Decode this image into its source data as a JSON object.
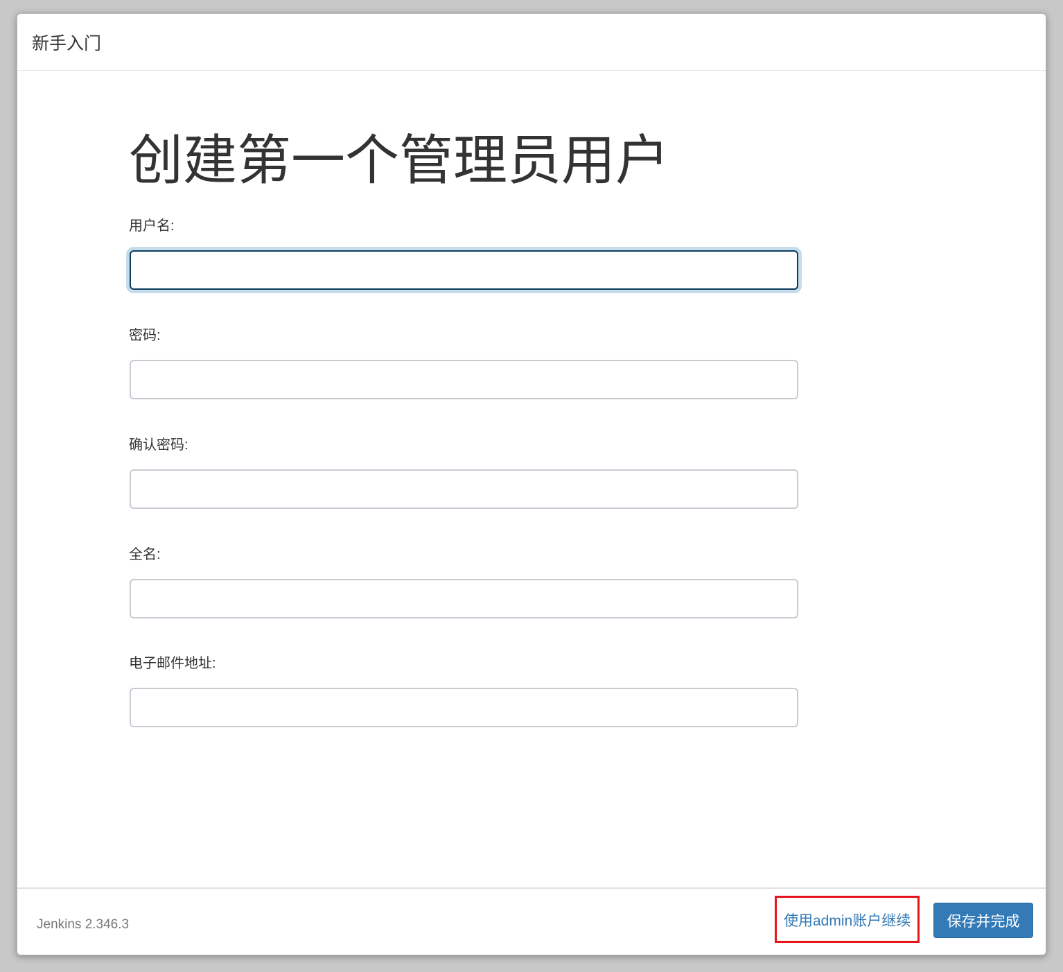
{
  "dialog": {
    "title": "新手入门"
  },
  "page": {
    "title": "创建第一个管理员用户"
  },
  "form": {
    "fields": [
      {
        "label": "用户名:",
        "value": ""
      },
      {
        "label": "密码:",
        "value": ""
      },
      {
        "label": "确认密码:",
        "value": ""
      },
      {
        "label": "全名:",
        "value": ""
      },
      {
        "label": "电子邮件地址:",
        "value": ""
      }
    ]
  },
  "footer": {
    "version": "Jenkins 2.346.3",
    "admin_link": "使用admin账户继续",
    "save_button": "保存并完成"
  },
  "colors": {
    "primary": "#337ab7",
    "highlight": "#e8141b",
    "focus_border": "#0d3a5c"
  }
}
